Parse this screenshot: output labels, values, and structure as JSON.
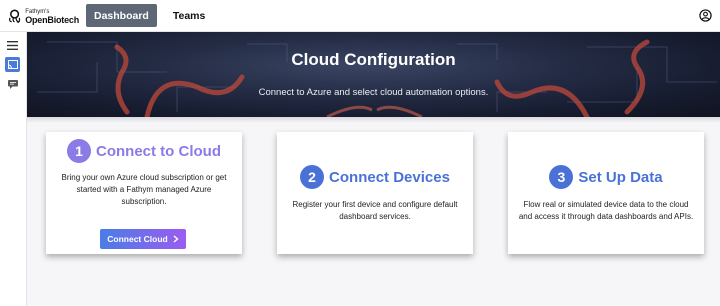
{
  "header": {
    "logo_small": "Fathym's",
    "logo_big": "OpenBiotech",
    "nav": [
      "Dashboard",
      "Teams"
    ],
    "account_icon": "account-circle-icon"
  },
  "rail": {
    "items": [
      "menu-icon",
      "cloud-cast-icon",
      "message-icon"
    ]
  },
  "hero": {
    "title": "Cloud Configuration",
    "subtitle": "Connect to Azure and select cloud automation options."
  },
  "steps": [
    {
      "number": "1",
      "title": "Connect to Cloud",
      "text": "Bring your own Azure cloud subscription or get started with a Fathym managed Azure subscription.",
      "button": "Connect Cloud",
      "color": "#8a7be6"
    },
    {
      "number": "2",
      "title": "Connect Devices",
      "text": "Register your first device and configure default dashboard services.",
      "color": "#4a72d6"
    },
    {
      "number": "3",
      "title": "Set Up Data",
      "text": "Flow real or simulated device data to the cloud and access it through data dashboards and APIs.",
      "color": "#4a72d6"
    }
  ]
}
